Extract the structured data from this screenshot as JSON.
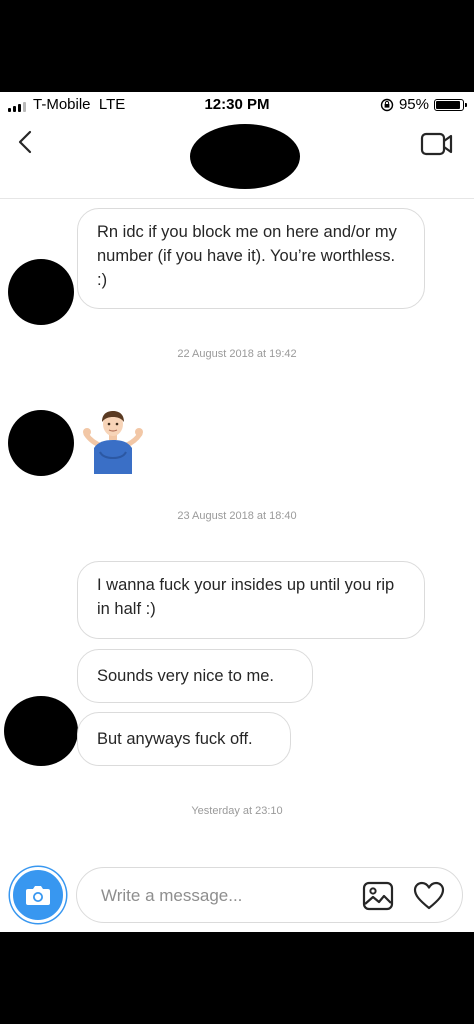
{
  "status_bar": {
    "carrier": "T-Mobile",
    "network": "LTE",
    "time": "12:30 PM",
    "battery_percent": "95%",
    "battery_level": 0.95
  },
  "header": {
    "back_icon": "chevron-left-icon",
    "video_icon": "video-camera-icon"
  },
  "messages": [
    {
      "type": "text",
      "text": "Rn idc if you block me on here and/or my number (if you have it). You’re worthless. :)"
    },
    {
      "type": "timestamp",
      "text": "22 August 2018 at 19:42"
    },
    {
      "type": "emoji",
      "text": "🤷🏻‍♂️",
      "icon": "shrug-emoji"
    },
    {
      "type": "timestamp",
      "text": "23 August 2018 at 18:40"
    },
    {
      "type": "text",
      "text": "I wanna fuck your insides up until you rip in half :)"
    },
    {
      "type": "text",
      "text": "Sounds very nice to me."
    },
    {
      "type": "text",
      "text": "But anyways fuck off."
    },
    {
      "type": "timestamp",
      "text": "Yesterday at 23:10"
    }
  ],
  "composer": {
    "placeholder": "Write a message...",
    "camera_icon": "camera-icon",
    "gallery_icon": "image-gallery-icon",
    "heart_icon": "heart-icon",
    "accent_color": "#3897f0"
  }
}
